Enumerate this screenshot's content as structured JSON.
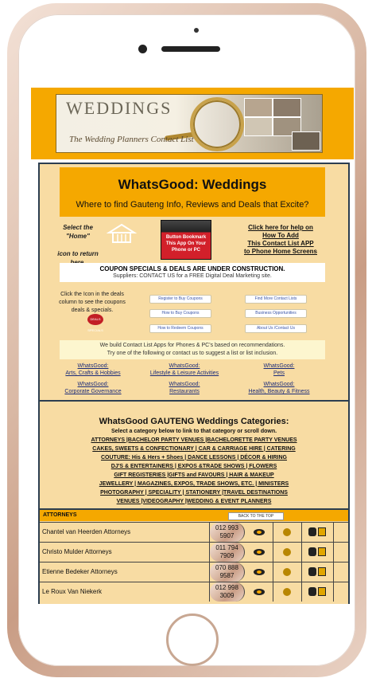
{
  "banner": {
    "title": "WEDDINGS",
    "subtitle": "The Wedding Planners Contact List"
  },
  "hero": {
    "title": "WhatsGood: Weddings",
    "subtitle": "Where to find Gauteng Info, Reviews and Deals that Excite?"
  },
  "home_hint": {
    "select_the": "Select the",
    "home": "\"Home\"",
    "return": "icon to return here."
  },
  "app_bookmark": "Button Bookmark This App On Your Phone or PC",
  "help_link": {
    "line1": "Click here for help on",
    "line2": "How To Add",
    "line3": "This Contact List APP",
    "line4": "to Phone Home Screens"
  },
  "coupon": {
    "line1": "COUPON SPECIALS & DEALS ARE UNDER CONSTRUCTION.",
    "line2": "Suppliers: CONTACT US for a FREE Digital Deal Marketing site."
  },
  "deals_hint": "Click the Icon in the deals column to see the coupons deals & specials.",
  "deal_badge": "DEALS SPECIALS",
  "pills": {
    "register": "Register to Buy Coupons",
    "find_more": "Find More Contact Lists",
    "how_buy": "How to Buy Coupons",
    "business": "Business Opportunities",
    "how_redeem": "How to Redeem Coupons",
    "about": "About Us /Contact Us"
  },
  "build_text": {
    "line1": "We build Contact List Apps for Phones & PC's based on recommendations.",
    "line2": "Try one of the following or contact us to suggest a list or list inclusion."
  },
  "cat_links": {
    "arts_1": "WhatsGood:",
    "arts_2": "Arts, Crafts & Hobbies",
    "life_1": "WhatsGood:",
    "life_2": "Lifestyle & Leisure Activities",
    "pets_1": "WhatsGood:",
    "pets_2": "Pets",
    "corp_1": "WhatsGood:",
    "corp_2": "Corporate Governance",
    "rest_1": "WhatsGood:",
    "rest_2": "Restaurants",
    "health_1": "WhatsGood:",
    "health_2": "Health, Beauty & Fitness"
  },
  "categories": {
    "title": "WhatsGood GAUTENG Weddings Categories:",
    "subtitle": "Select a category below to link to that category or scroll down.",
    "lines": [
      "ATTORNEYS |BACHELOR PARTY VENUES |BACHELORETTE PARTY VENUES",
      "CAKES, SWEETS & CONFECTIONARY | CAR & CARRIAGE HIRE | CATERING",
      "COUTURE: His & Hers + Shoes | DANCE LESSONS | DÉCOR & HIRING",
      "DJ'S & ENTERTAINERS | EXPOS &TRADE SHOWS | FLOWERS",
      "GIFT REGISTERIES |GIFTS and FAVOURS | HAIR & MAKEUP",
      "JEWELLERY | MAGAZINES, EXPOS, TRADE SHOWS, ETC. | MINISTERS",
      "PHOTOGRAPHY | SPECIALITY | STATIONERY |TRAVEL DESTINATIONS",
      "VENUES |VIDEOGRAPHY |WEDDING & EVENT PLANNERS"
    ]
  },
  "attorneys": {
    "label": "ATTORNEYS",
    "back_to_top": "BACK TO THE TOP",
    "rows": [
      {
        "name": "Chantel van Heerden Attorneys",
        "phone1": "012 993",
        "phone2": "5907"
      },
      {
        "name": "Christo Mulder Attorneys",
        "phone1": "011 794",
        "phone2": "7909"
      },
      {
        "name": "Etienne Bedeker Attorneys",
        "phone1": "070 888",
        "phone2": "9587"
      },
      {
        "name": "Le Roux Van Niekerk",
        "phone1": "012 998",
        "phone2": "3009"
      }
    ]
  }
}
